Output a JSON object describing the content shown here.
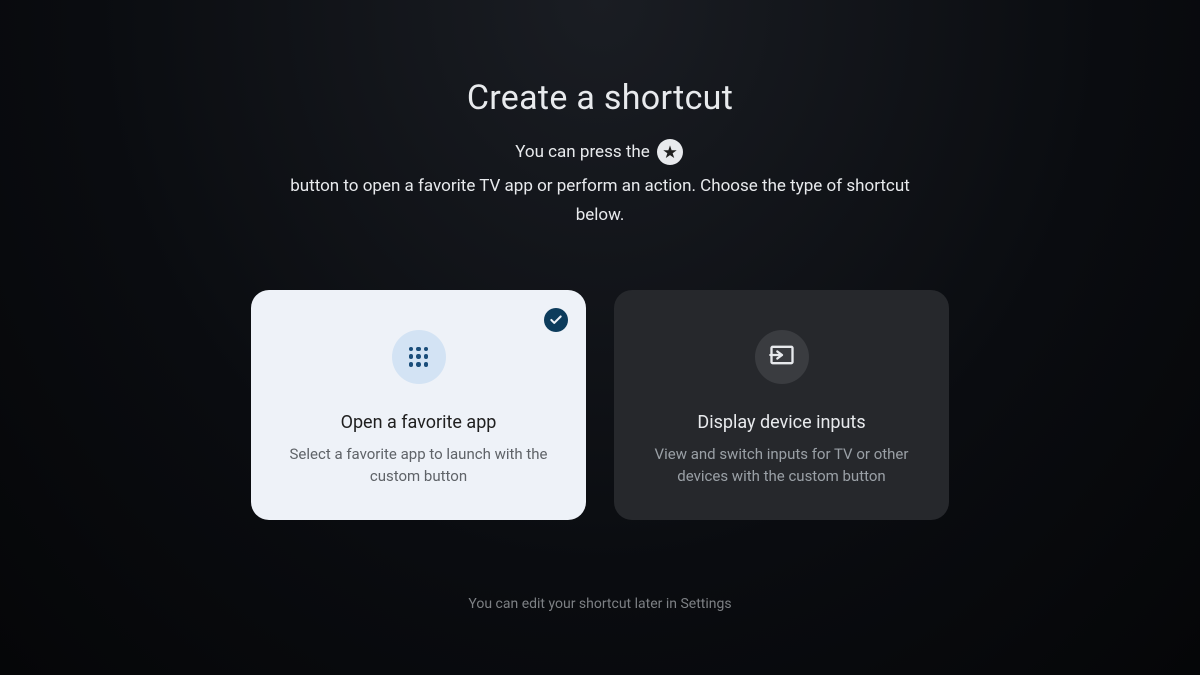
{
  "page": {
    "title": "Create a shortcut",
    "subtitle_part1": "You can press the",
    "subtitle_part2": "button to open a favorite TV app or perform an action. Choose the type of shortcut below.",
    "footer": "You can edit your shortcut later in Settings"
  },
  "cards": {
    "option1": {
      "title": "Open a favorite app",
      "description": "Select a favorite app to launch with the custom button"
    },
    "option2": {
      "title": "Display device inputs",
      "description": "View and switch inputs for TV or other devices with the custom button"
    }
  }
}
